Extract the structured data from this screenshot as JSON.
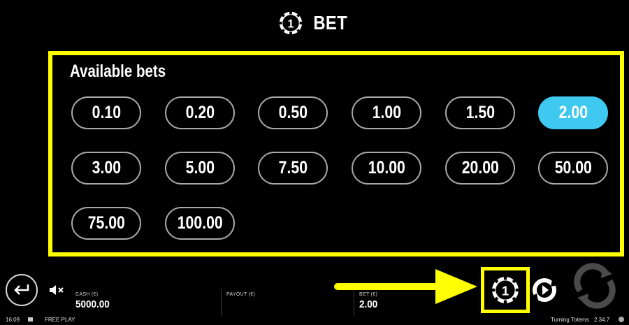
{
  "header": {
    "title": "BET",
    "icon": "bet-chip-icon"
  },
  "bets": {
    "label": "Available bets",
    "options": [
      "0.10",
      "0.20",
      "0.50",
      "1.00",
      "1.50",
      "2.00",
      "3.00",
      "5.00",
      "7.50",
      "10.00",
      "20.00",
      "50.00",
      "75.00",
      "100.00"
    ],
    "selected": "2.00"
  },
  "bottom": {
    "cash_label": "CASH (€)",
    "cash_value": "5000.00",
    "payout_label": "PAYOUT (€)",
    "payout_value": "",
    "bet_label": "BET (€)",
    "bet_value": "2.00"
  },
  "status": {
    "time": "16:09",
    "mode": "FREE PLAY",
    "game": "Turning Totems",
    "version": "2.34.7"
  },
  "colors": {
    "highlight": "#ffff00",
    "selected_bet": "#3fc8f0",
    "background": "#000000"
  },
  "icons": {
    "back": "back-arrow-icon",
    "mute": "speaker-muted-icon",
    "autoplay": "autoplay-icon",
    "spin": "spin-icon",
    "info": "info-icon"
  }
}
